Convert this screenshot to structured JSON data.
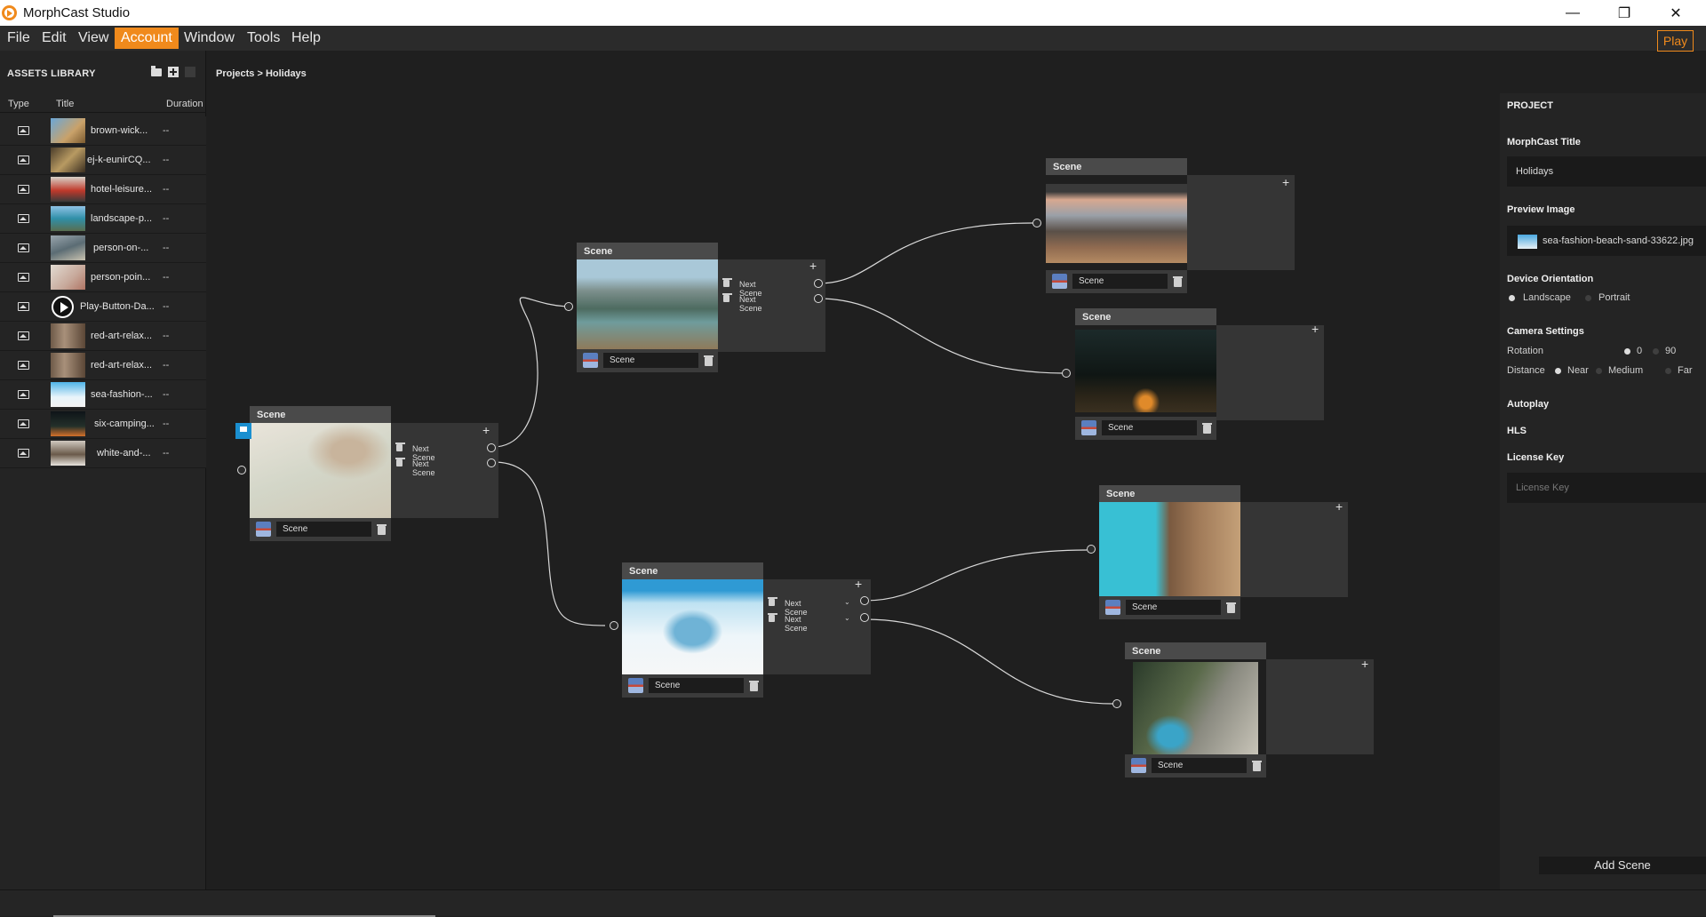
{
  "window": {
    "title": "MorphCast Studio",
    "minimize": "—",
    "maximize": "❐",
    "close": "✕"
  },
  "menu": {
    "items": [
      "File",
      "Edit",
      "View",
      "Account",
      "Window",
      "Tools",
      "Help"
    ],
    "active": "Account",
    "play": "Play"
  },
  "assets": {
    "title": "ASSETS  LIBRARY",
    "columns": {
      "type": "Type",
      "title": "Title",
      "duration": "Duration"
    },
    "rows": [
      {
        "title": "brown-wick...",
        "duration": "--"
      },
      {
        "title": "ej-k-eunirCQ...",
        "duration": "--"
      },
      {
        "title": "hotel-leisure...",
        "duration": "--"
      },
      {
        "title": "landscape-p...",
        "duration": "--"
      },
      {
        "title": "person-on-...",
        "duration": "--"
      },
      {
        "title": "person-poin...",
        "duration": "--"
      },
      {
        "title": "Play-Button-Da...",
        "duration": "--"
      },
      {
        "title": "red-art-relax...",
        "duration": "--"
      },
      {
        "title": "red-art-relax...",
        "duration": "--"
      },
      {
        "title": "sea-fashion-...",
        "duration": "--"
      },
      {
        "title": "six-camping...",
        "duration": "--"
      },
      {
        "title": "white-and-...",
        "duration": "--"
      }
    ]
  },
  "canvas": {
    "breadcrumb": "Projects > Holidays",
    "nodes": [
      {
        "id": "n1",
        "header": "Scene",
        "name": "Scene",
        "outputs": [
          "Next Scene",
          "Next Scene"
        ]
      },
      {
        "id": "n2",
        "header": "Scene",
        "name": "Scene",
        "outputs": [
          "Next Scene",
          "Next Scene"
        ]
      },
      {
        "id": "n3",
        "header": "Scene",
        "name": "Scene",
        "outputs": [
          "Next Scene",
          "Next Scene"
        ]
      },
      {
        "id": "n4",
        "header": "Scene",
        "name": "Scene",
        "outputs": []
      },
      {
        "id": "n5",
        "header": "Scene",
        "name": "Scene",
        "outputs": []
      },
      {
        "id": "n6",
        "header": "Scene",
        "name": "Scene",
        "outputs": []
      },
      {
        "id": "n7",
        "header": "Scene",
        "name": "Scene",
        "outputs": []
      }
    ]
  },
  "project": {
    "title": "PROJECT",
    "morphcast_title_label": "MorphCast Title",
    "morphcast_title_value": "Holidays",
    "preview_label": "Preview Image",
    "preview_value": "sea-fashion-beach-sand-33622.jpg",
    "orientation_label": "Device Orientation",
    "orientation_options": [
      "Landscape",
      "Portrait"
    ],
    "orientation_selected": "Landscape",
    "camera_label": "Camera Settings",
    "rotation_label": "Rotation",
    "rotation_options": [
      "0",
      "90"
    ],
    "rotation_selected": "0",
    "distance_label": "Distance",
    "distance_options": [
      "Near",
      "Medium",
      "Far"
    ],
    "distance_selected": "Near",
    "autoplay_label": "Autoplay",
    "hls_label": "HLS",
    "license_label": "License Key",
    "license_placeholder": "License Key",
    "add_scene": "Add Scene"
  }
}
